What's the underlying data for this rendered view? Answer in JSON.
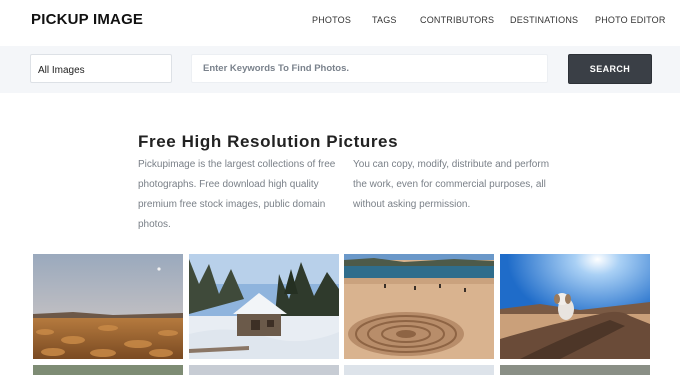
{
  "brand": {
    "logo_text": "PICKUP IMAGE"
  },
  "nav": {
    "items": [
      {
        "label": "PHOTOS"
      },
      {
        "label": "TAGS"
      },
      {
        "label": "CONTRIBUTORS"
      },
      {
        "label": "DESTINATIONS"
      },
      {
        "label": "PHOTO EDITOR"
      }
    ]
  },
  "search": {
    "category_selected": "All Images",
    "placeholder": "Enter Keywords To Find Photos.",
    "value": "",
    "button_label": "SEARCH"
  },
  "intro": {
    "title": "Free High Resolution Pictures",
    "paragraph_left": "Pickupimage is the largest collections of free photographs. Free download high quality premium free stock images, public domain photos.",
    "paragraph_right": "You can copy, modify, distribute and perform the work, even for commercial purposes, all without asking permission."
  },
  "gallery": {
    "images": [
      {
        "subject": "dry-grassland-dusk-photo"
      },
      {
        "subject": "snowy-cabin-forest-photo"
      },
      {
        "subject": "beach-sand-mandala-photo"
      },
      {
        "subject": "dog-on-rock-sunburst-photo"
      }
    ],
    "colors": {
      "sky_dusk": "#a8b4c4",
      "snow": "#e9eef4",
      "sea": "#2f6d8c",
      "sky_blue": "#2a78d6"
    }
  }
}
